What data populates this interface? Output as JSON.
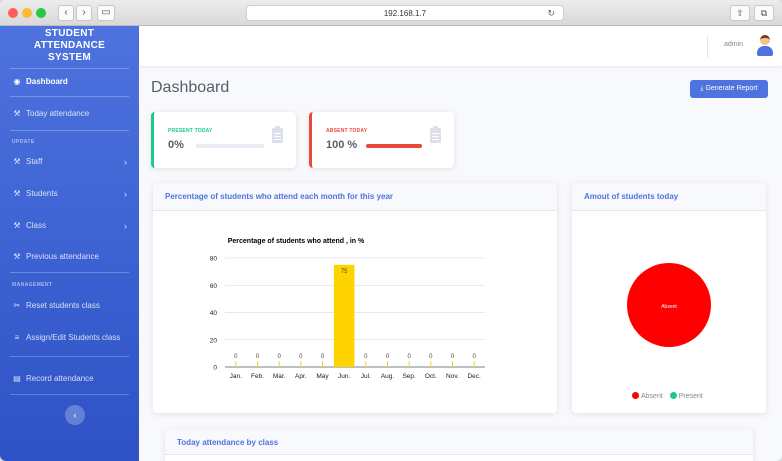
{
  "browser": {
    "url": "192.168.1.7"
  },
  "sidebar": {
    "brand": [
      "STUDENT",
      "ATTENDANCE",
      "SYSTEM"
    ],
    "items": [
      {
        "label": "Dashboard",
        "icon": "tachometer-icon"
      },
      {
        "label": "Today attendance",
        "icon": "wrench-icon"
      },
      {
        "label": "Staff",
        "icon": "wrench-icon"
      },
      {
        "label": "Students",
        "icon": "wrench-icon"
      },
      {
        "label": "Class",
        "icon": "wrench-icon"
      },
      {
        "label": "Previous attendance",
        "icon": "wrench-icon"
      },
      {
        "label": "Reset students class",
        "icon": "tools-icon"
      },
      {
        "label": "Assign/Edit Students class",
        "icon": "list-icon"
      },
      {
        "label": "Record attendance",
        "icon": "file-icon"
      }
    ],
    "headings": {
      "update": "UPDATE",
      "management": "MANAGEMENT"
    }
  },
  "topbar": {
    "username": "admin"
  },
  "page": {
    "title": "Dashboard",
    "generate_label": "Generate Report"
  },
  "stats": {
    "present": {
      "label": "PRESENT TODAY",
      "value": "0%",
      "fraction": 0.0,
      "color": "#1cc88a"
    },
    "absent": {
      "label": "ABSENT TODAY",
      "value": "100 %",
      "fraction": 1.0,
      "color": "#e74a3b"
    }
  },
  "cards": {
    "monthly_title": "Percentage of students who attend each month for this year",
    "today_title": "Amout of students today",
    "by_class_title": "Today attendance by class"
  },
  "chart_data": [
    {
      "type": "bar",
      "title": "Percentage of students who attend , in %",
      "categories": [
        "Jan.",
        "Feb.",
        "Mar.",
        "Apr.",
        "May",
        "Jun.",
        "Jul.",
        "Aug.",
        "Sep.",
        "Oct.",
        "Nov.",
        "Dec."
      ],
      "values": [
        0,
        0,
        0,
        0,
        0,
        75,
        0,
        0,
        0,
        0,
        0,
        0
      ],
      "data_labels": [
        "0",
        "0",
        "0",
        "0",
        "0",
        "75",
        "0",
        "0",
        "0",
        "0",
        "0",
        "0"
      ],
      "yticks": [
        "0",
        "20",
        "40",
        "60",
        "80"
      ],
      "ylim": [
        0,
        80
      ],
      "grid": true,
      "color": "#ffd300"
    },
    {
      "type": "pie",
      "categories": [
        "Absent",
        "Present"
      ],
      "values": [
        100,
        0
      ],
      "colors": [
        "#ff0000",
        "#1cc88a"
      ],
      "slice_label": "Absent",
      "legend": "bottom"
    }
  ]
}
